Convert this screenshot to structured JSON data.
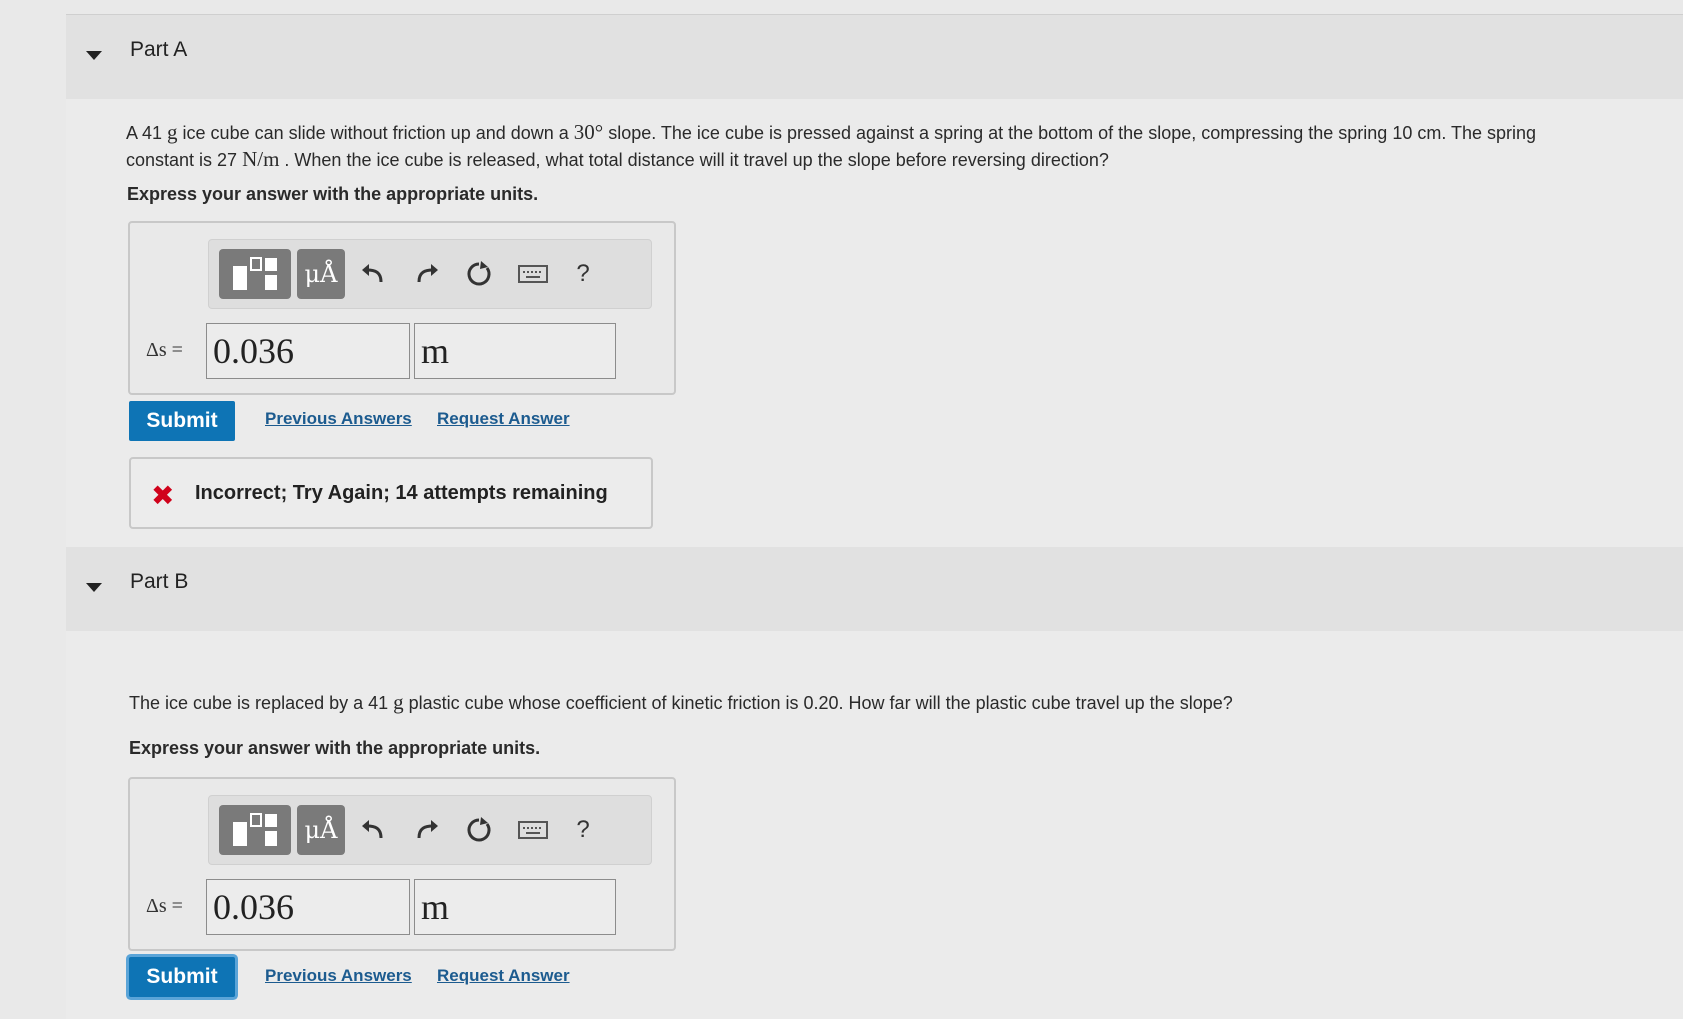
{
  "partA": {
    "title": "Part A",
    "question": {
      "t1": "A 41 ",
      "u1": "g",
      "t2": " ice cube can slide without friction up and down a ",
      "u2": "30°",
      "t3": " slope. The ice cube is pressed against a spring at the bottom of the slope, compressing the spring 10 cm. The spring",
      "t4": "constant is 27 ",
      "u3": "N/m",
      "t5": " . When the ice cube is released, what total distance will it travel up the slope before reversing direction?"
    },
    "express": "Express your answer with the appropriate units.",
    "toolbar": {
      "templates_icon": "templates-icon",
      "units_label": "μÅ",
      "undo_icon": "undo-icon",
      "redo_icon": "redo-icon",
      "reset_icon": "reset-icon",
      "keyboard_icon": "keyboard-icon",
      "help_label": "?"
    },
    "answer_label": "Δs =",
    "value": "0.036",
    "unit": "m",
    "submit_label": "Submit",
    "previous_answers": "Previous Answers",
    "request_answer": "Request Answer",
    "feedback": {
      "icon": "✖",
      "message": "Incorrect; Try Again; 14 attempts remaining"
    }
  },
  "partB": {
    "title": "Part B",
    "question": {
      "t1": "The ice cube is replaced by a 41 ",
      "u1": "g",
      "t2": " plastic cube whose coefficient of kinetic friction is 0.20. How far will the plastic cube travel up the slope?"
    },
    "express": "Express your answer with the appropriate units.",
    "toolbar": {
      "units_label": "μÅ",
      "help_label": "?"
    },
    "answer_label": "Δs =",
    "value": "0.036",
    "unit": "m",
    "submit_label": "Submit",
    "previous_answers": "Previous Answers",
    "request_answer": "Request Answer"
  },
  "colors": {
    "submit": "#0e74b5",
    "link": "#1c5b8f",
    "error": "#d0021b",
    "toolbar_button": "#7a7a7a"
  }
}
